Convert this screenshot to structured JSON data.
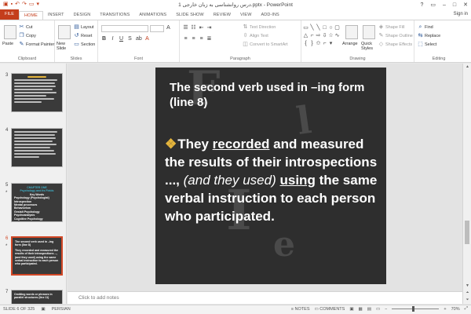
{
  "window": {
    "title": "درس روانشناسی به زبان خارجی 1.pptx - PowerPoint",
    "signin": "Sign in",
    "controls": [
      "?",
      "▭",
      "–",
      "□",
      "✕"
    ]
  },
  "ribbon_tabs": [
    "FILE",
    "HOME",
    "INSERT",
    "DESIGN",
    "TRANSITIONS",
    "ANIMATIONS",
    "SLIDE SHOW",
    "REVIEW",
    "VIEW",
    "ADD-INS"
  ],
  "ribbon": {
    "clipboard": {
      "paste": "Paste",
      "cut": "Cut",
      "copy": "Copy",
      "format_painter": "Format Painter",
      "label": "Clipboard"
    },
    "slides": {
      "new_slide": "New Slide",
      "layout": "Layout",
      "reset": "Reset",
      "section": "Section",
      "label": "Slides"
    },
    "font": {
      "label": "Font"
    },
    "paragraph": {
      "text_direction": "Text Direction",
      "align_text": "Align Text",
      "convert_smartart": "Convert to SmartArt",
      "label": "Paragraph"
    },
    "drawing": {
      "arrange": "Arrange",
      "quick_styles": "Quick Styles",
      "shape_fill": "Shape Fill",
      "shape_outline": "Shape Outline",
      "shape_effects": "Shape Effects",
      "label": "Drawing"
    },
    "editing": {
      "find": "Find",
      "replace": "Replace",
      "select": "Select",
      "label": "Editing"
    }
  },
  "thumbnails": [
    {
      "num": "3",
      "selected": false
    },
    {
      "num": "4",
      "selected": false
    },
    {
      "num": "5",
      "selected": false,
      "lines": [
        "CHAPTER ONE",
        "Psychology and its Fields",
        "Key Words",
        "Psychology (Psychologist)",
        "Introspection",
        "Mental processes",
        "Behaviorism",
        "Gestalt Psychology",
        "Psychoanalysis",
        "Cognitive Psychology"
      ]
    },
    {
      "num": "6",
      "selected": true,
      "lines": [
        "The second verb used in –ing form (line 8)",
        "They recorded and measured the results of their introspections ..., (and they used) using the same verbal instruction to each person who participated."
      ]
    },
    {
      "num": "7",
      "selected": false,
      "lines": [
        "Omitting words or phrases in parallel structures (line 11)"
      ]
    }
  ],
  "slide": {
    "heading": "The second verb used in –ing form (line 8)",
    "body_parts": [
      {
        "text": "They ",
        "style": "normal"
      },
      {
        "text": "recorded",
        "style": "underline"
      },
      {
        "text": " and measured the results of their introspections ..., ",
        "style": "normal"
      },
      {
        "text": "(and they used)",
        "style": "italic"
      },
      {
        "text": " ",
        "style": "normal"
      },
      {
        "text": "using",
        "style": "underline"
      },
      {
        "text": " the same verbal instruction to each person who participated.",
        "style": "normal"
      }
    ]
  },
  "notes": {
    "placeholder": "Click to add notes"
  },
  "status": {
    "slide_indicator": "SLIDE 6 OF 325",
    "language": "PERSIAN",
    "notes": "NOTES",
    "comments": "COMMENTS",
    "zoom": "70%"
  },
  "colors": {
    "accent": "#c43e1c",
    "slide_bg": "#2e2e2e",
    "bullet": "#e4b43c",
    "selected_thumb": "#d24726"
  }
}
